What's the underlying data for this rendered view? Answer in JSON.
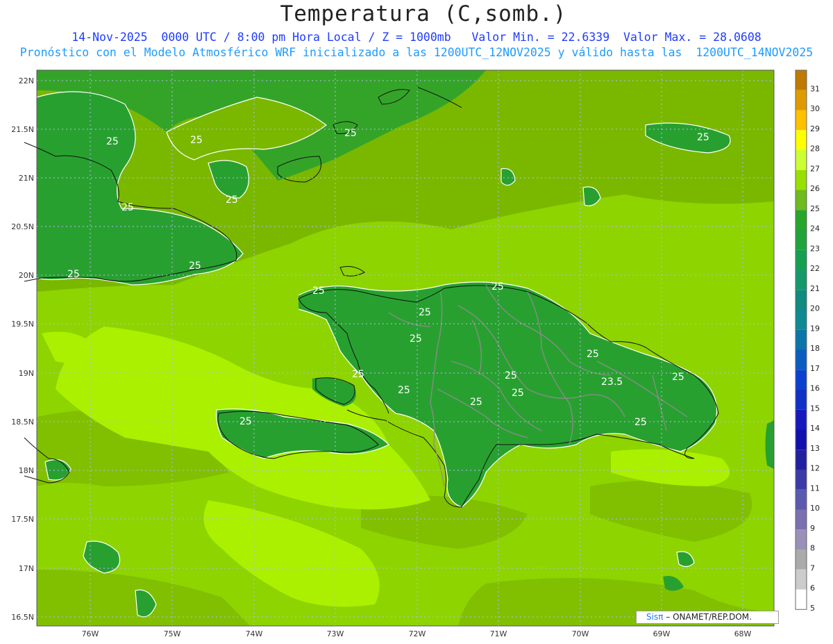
{
  "title": "Temperatura (C,somb.)",
  "subtitle_line1": "14-Nov-2025  0000 UTC / 8:00 pm Hora Local / Z = 1000mb   Valor Min. = 22.6339  Valor Max. = 28.0608",
  "subtitle_line2": "Pronóstico con el Modelo Atmosférico WRF inicializado a las 1200UTC_12NOV2025 y válido hasta las  1200UTC_14NOV2025",
  "lat_labels": [
    "22N",
    "21.5N",
    "21N",
    "20.5N",
    "20N",
    "19.5N",
    "19N",
    "18.5N",
    "18N",
    "17.5N",
    "17N",
    "16.5N"
  ],
  "lon_labels": [
    "76W",
    "75W",
    "74W",
    "73W",
    "72W",
    "71W",
    "70W",
    "69W",
    "68W"
  ],
  "colorbar": {
    "labels": [
      "31",
      "30",
      "29",
      "28",
      "27",
      "26",
      "25",
      "24",
      "23",
      "22",
      "21",
      "20",
      "19",
      "18",
      "17",
      "16",
      "15",
      "14",
      "13",
      "12",
      "11",
      "10",
      "9",
      "8",
      "7",
      "6",
      "5"
    ],
    "colors": [
      "#c07a00",
      "#e09a00",
      "#ffc000",
      "#ffff00",
      "#ccff33",
      "#99e000",
      "#6fba1c",
      "#28a62a",
      "#1fa33a",
      "#15a050",
      "#139a6a",
      "#118a80",
      "#0d8a92",
      "#0a75a8",
      "#0a5cc0",
      "#0a40d0",
      "#1030c8",
      "#1818c0",
      "#1010b0",
      "#2020a0",
      "#3a3aa8",
      "#5a5ab0",
      "#7a70b0",
      "#9a90b8",
      "#aaaaaa",
      "#cccccc",
      "#ffffff"
    ]
  },
  "isoline_labels": [
    "25",
    "25",
    "25",
    "25",
    "25",
    "25",
    "25",
    "25",
    "25",
    "25",
    "25",
    "25",
    "25",
    "25",
    "25",
    "25",
    "25",
    "23.5",
    "25",
    "25",
    "25",
    "25"
  ],
  "credit": {
    "brand": "Sisπ",
    "text": " – ONAMET/REP.DOM."
  },
  "colors": {
    "ocean_main": "#8ed400",
    "ocean_light": "#aaf000",
    "ocean_dark": "#7ab800",
    "land_green": "#28a030",
    "coastline": "#111111",
    "borders": "#8c8c8c",
    "grid": "#b8b8f0"
  }
}
